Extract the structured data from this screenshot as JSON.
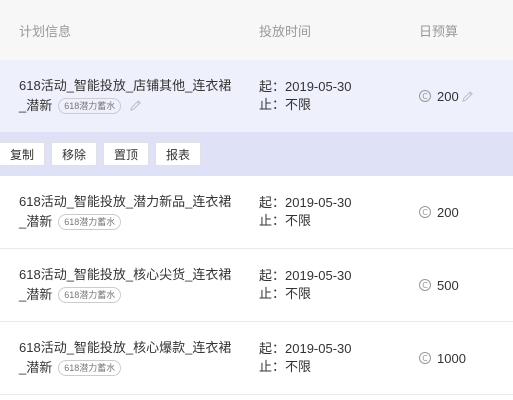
{
  "header": {
    "col_plan": "计划信息",
    "col_time": "投放时间",
    "col_budget": "日预算"
  },
  "rows": [
    {
      "title_line1": "618活动_智能投放_店铺其他_连衣裙",
      "title_line2": "_潜新",
      "tag": "618潜力蓄水",
      "start_label": "起：",
      "start": "2019-05-30",
      "end_label": "止：",
      "end": "不限",
      "coin_symbol": "C",
      "budget": "200"
    },
    {
      "title_line1": "618活动_智能投放_潜力新品_连衣裙",
      "title_line2": "_潜新",
      "tag": "618潜力蓄水",
      "start_label": "起：",
      "start": "2019-05-30",
      "end_label": "止：",
      "end": "不限",
      "coin_symbol": "C",
      "budget": "200"
    },
    {
      "title_line1": "618活动_智能投放_核心尖货_连衣裙",
      "title_line2": "_潜新",
      "tag": "618潜力蓄水",
      "start_label": "起：",
      "start": "2019-05-30",
      "end_label": "止：",
      "end": "不限",
      "coin_symbol": "C",
      "budget": "500"
    },
    {
      "title_line1": "618活动_智能投放_核心爆款_连衣裙",
      "title_line2": "_潜新",
      "tag": "618潜力蓄水",
      "start_label": "起：",
      "start": "2019-05-30",
      "end_label": "止：",
      "end": "不限",
      "coin_symbol": "C",
      "budget": "1000"
    }
  ],
  "actions": {
    "copy": "复制",
    "remove": "移除",
    "pin": "置顶",
    "report": "报表"
  },
  "colors": {
    "selected_row": "#eef0fb",
    "action_bar": "#dfe2f7"
  }
}
